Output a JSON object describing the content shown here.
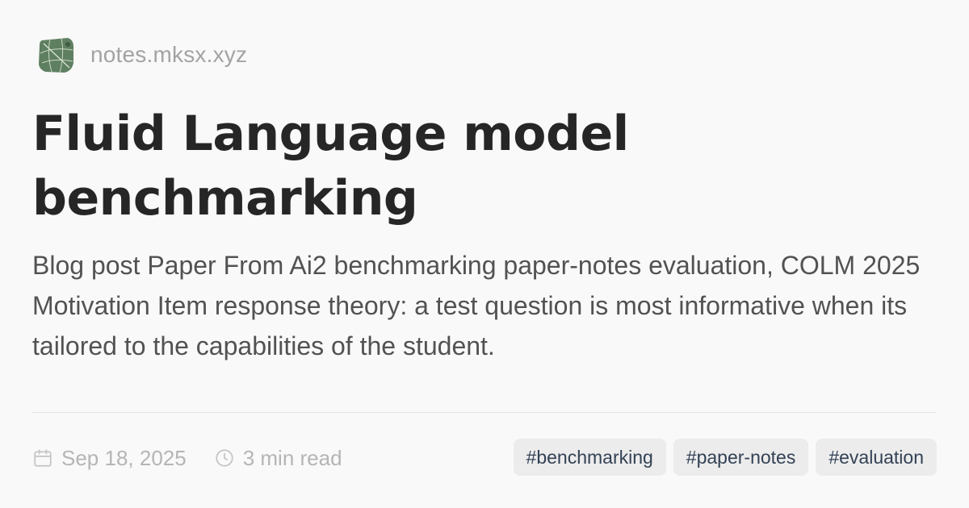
{
  "site": {
    "name": "notes.mksx.xyz",
    "logo_icon": "globe-map-logo-icon"
  },
  "post": {
    "title_line1": "Fluid Language model",
    "title_line2": "benchmarking",
    "excerpt": "Blog post Paper From Ai2 benchmarking paper-notes evaluation, COLM 2025 Motivation Item response theory: a test question is most informative when its tailored to the capabilities of the student."
  },
  "meta": {
    "date": "Sep 18, 2025",
    "date_icon": "calendar-icon",
    "read_time": "3 min read",
    "read_time_icon": "clock-icon"
  },
  "tags": [
    {
      "label": "#benchmarking"
    },
    {
      "label": "#paper-notes"
    },
    {
      "label": "#evaluation"
    }
  ],
  "colors": {
    "background": "#f9f9f9",
    "title": "#262626",
    "excerpt": "#525252",
    "muted": "#a3a3a3",
    "tag_bg": "#ececec",
    "tag_text": "#334155",
    "logo_green": "#5f7f61"
  }
}
